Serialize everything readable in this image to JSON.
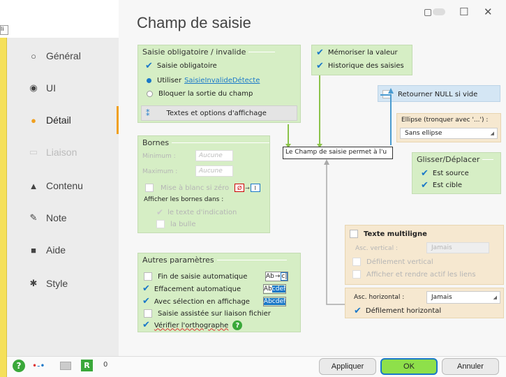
{
  "window": {
    "title": "Champ de saisie",
    "lock_icon": "lock-icon",
    "maximize_symbol": "☐",
    "close_symbol": "✕",
    "top_field_text": "li"
  },
  "sidebar": {
    "items": [
      {
        "label": "Général",
        "icon": "○"
      },
      {
        "label": "UI",
        "icon": "◉"
      },
      {
        "label": "Détail",
        "icon": "●"
      },
      {
        "label": "Liaison",
        "icon": "▭"
      },
      {
        "label": "Contenu",
        "icon": "▲"
      },
      {
        "label": "Note",
        "icon": "✎"
      },
      {
        "label": "Aide",
        "icon": "■"
      },
      {
        "label": "Style",
        "icon": "✱"
      }
    ],
    "active_index": 2
  },
  "saisie": {
    "title": "Saisie obligatoire / invalide",
    "obligatoire": "Saisie obligatoire",
    "utiliser": "Utiliser",
    "utiliser_link": "SaisieInvalideDétecte",
    "bloquer": "Bloquer la sortie du champ",
    "textes_options": "Textes et options d'affichage"
  },
  "memo": {
    "memoriser": "Mémoriser la valeur",
    "historique": "Historique des saisies"
  },
  "null_panel": {
    "label": "Retourner NULL si vide"
  },
  "ellipse": {
    "title": "Ellipse (tronquer avec '...') :",
    "value": "Sans ellipse"
  },
  "glisser": {
    "title": "Glisser/Déplacer",
    "source": "Est source",
    "cible": "Est cible"
  },
  "hint_text": "Le Champ de saisie permet à l'u",
  "bornes": {
    "title": "Bornes",
    "minimum": "Minimum :",
    "maximum": "Maximum :",
    "min_placeholder": "Aucune",
    "max_placeholder": "Aucune",
    "mise_a_blanc": "Mise à blanc si zéro",
    "afficher": "Afficher les bornes dans :",
    "texte_indication": "le texte d'indication",
    "bulle": "la bulle",
    "zero_sample": "Ø",
    "blank_sample": "I"
  },
  "autres": {
    "title": "Autres paramètres",
    "fin_saisie": "Fin de saisie automatique",
    "effacement": "Effacement automatique",
    "selection": "Avec sélection en affichage",
    "assistee": "Saisie assistée sur liaison fichier",
    "orthographe": "Vérifier l'orthographe",
    "sample1": "Ab",
    "sample1b": "c|",
    "sample2a": "Ab",
    "sample2b": "cdef",
    "sample3a": "Ab",
    "sample3b": "cdef"
  },
  "multiligne": {
    "title": "Texte multiligne",
    "asc_vertical": "Asc. vertical :",
    "asc_vertical_value": "Jamais",
    "defilement_vertical": "Défilement vertical",
    "afficher_rendre": "Afficher et rendre actif les liens"
  },
  "horizontal": {
    "asc_horizontal": "Asc. horizontal :",
    "asc_horizontal_value": "Jamais",
    "defilement_horizontal": "Défilement horizontal"
  },
  "footer": {
    "appliquer": "Appliquer",
    "ok": "OK",
    "annuler": "Annuler",
    "counter": "0",
    "help_icon": "?"
  },
  "colors": {
    "accent_orange": "#f0a020",
    "ok_green": "#8ee04a",
    "check_blue": "#1a78c8",
    "panel_green": "#d6eec5",
    "panel_orange": "#f6e8d0",
    "panel_blue": "#d4e6f4"
  }
}
